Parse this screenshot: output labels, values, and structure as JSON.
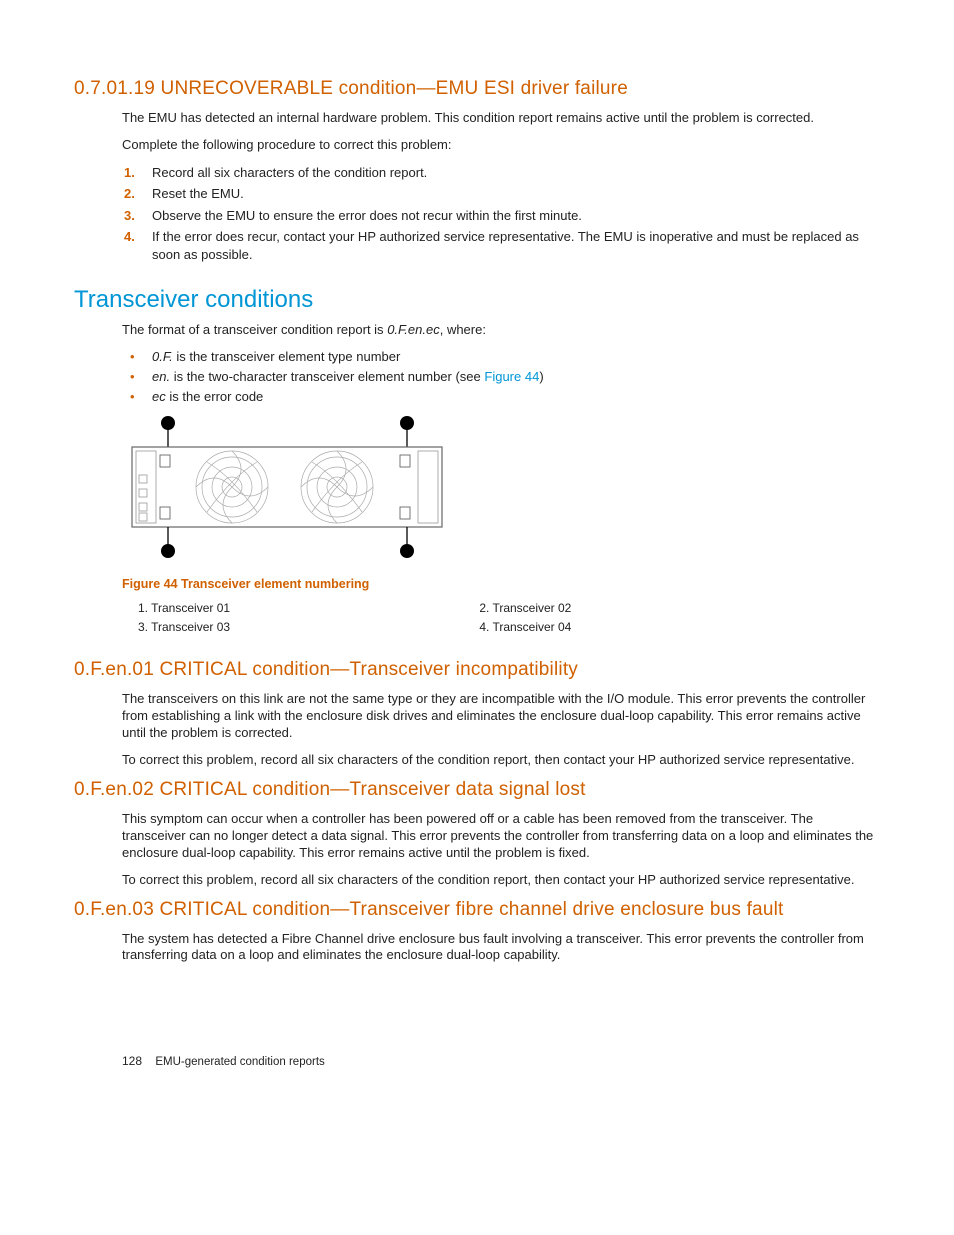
{
  "sections": {
    "s1": {
      "heading": "0.7.01.19 UNRECOVERABLE condition—EMU ESI driver failure",
      "p1": "The EMU has detected an internal hardware problem. This condition report remains active until the problem is corrected.",
      "p2": "Complete the following procedure to correct this problem:",
      "ol": [
        "Record all six characters of the condition report.",
        "Reset the EMU.",
        "Observe the EMU to ensure the error does not recur within the first minute.",
        "If the error does recur, contact your HP authorized service representative. The EMU is inoperative and must be replaced as soon as possible."
      ]
    },
    "s2": {
      "heading": "Transceiver conditions",
      "p1_a": "The format of a transceiver condition report is ",
      "p1_b": "0.F.en.ec",
      "p1_c": ", where:",
      "li1_a": "0.F.",
      "li1_b": " is the transceiver element type number",
      "li2_a": "en.",
      "li2_b": " is the two-character transceiver element number (see ",
      "li2_link": "Figure 44",
      "li2_c": ")",
      "li3_a": "ec",
      "li3_b": " is the error code",
      "figcap": "Figure 44 Transceiver element numbering",
      "legend": {
        "a": "1. Transceiver 01",
        "b": "2. Transceiver 02",
        "c": "3. Transceiver 03",
        "d": "4. Transceiver 04"
      }
    },
    "s3": {
      "heading": "0.F.en.01 CRITICAL condition—Transceiver incompatibility",
      "p1": "The transceivers on this link are not the same type or they are incompatible with the I/O module. This error prevents the controller from establishing a link with the enclosure disk drives and eliminates the enclosure dual-loop capability. This error remains active until the problem is corrected.",
      "p2": "To correct this problem, record all six characters of the condition report, then contact your HP authorized service representative."
    },
    "s4": {
      "heading": "0.F.en.02 CRITICAL condition—Transceiver data signal lost",
      "p1": "This symptom can occur when a controller has been powered off or a cable has been removed from the transceiver. The transceiver can no longer detect a data signal. This error prevents the controller from transferring data on a loop and eliminates the enclosure dual-loop capability. This error remains active until the problem is fixed.",
      "p2": "To correct this problem, record all six characters of the condition report, then contact your HP authorized service representative."
    },
    "s5": {
      "heading": "0.F.en.03 CRITICAL condition—Transceiver fibre channel drive enclosure bus fault",
      "p1": "The system has detected a Fibre Channel drive enclosure bus fault involving a transceiver. This error prevents the controller from transferring data on a loop and eliminates the enclosure dual-loop capability."
    }
  },
  "footer": {
    "page": "128",
    "title": "EMU-generated condition reports"
  }
}
